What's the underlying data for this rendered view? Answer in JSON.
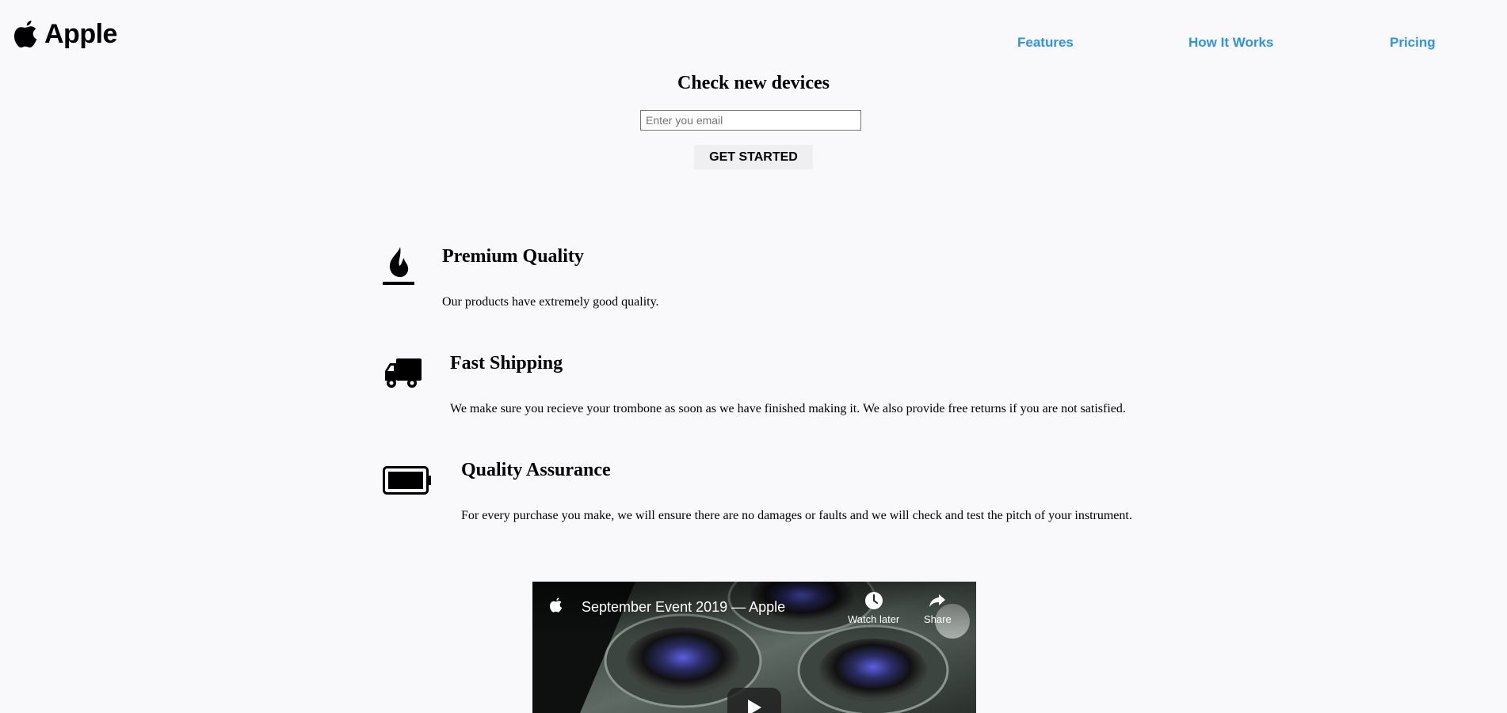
{
  "header": {
    "logo_text": "Apple",
    "logo_icon": "apple-logo-icon",
    "nav": [
      {
        "label": "Features"
      },
      {
        "label": "How It Works"
      },
      {
        "label": "Pricing"
      }
    ],
    "nav_color": "#2b94e6"
  },
  "hero": {
    "title": "Check new devices",
    "email_placeholder": "Enter you email",
    "cta_label": "GET STARTED"
  },
  "features": [
    {
      "icon": "fire-icon",
      "title": "Premium Quality",
      "description": "Our products have extremely good quality."
    },
    {
      "icon": "truck-icon",
      "title": "Fast Shipping",
      "description": "We make sure you recieve your trombone as soon as we have finished making it. We also provide free returns if you are not satisfied."
    },
    {
      "icon": "battery-full-icon",
      "title": "Quality Assurance",
      "description": "For every purchase you make, we will ensure there are no damages or faults and we will check and test the pitch of your instrument."
    }
  ],
  "video": {
    "title": "September Event 2019 — Apple",
    "watch_later_label": "Watch later",
    "share_label": "Share"
  }
}
